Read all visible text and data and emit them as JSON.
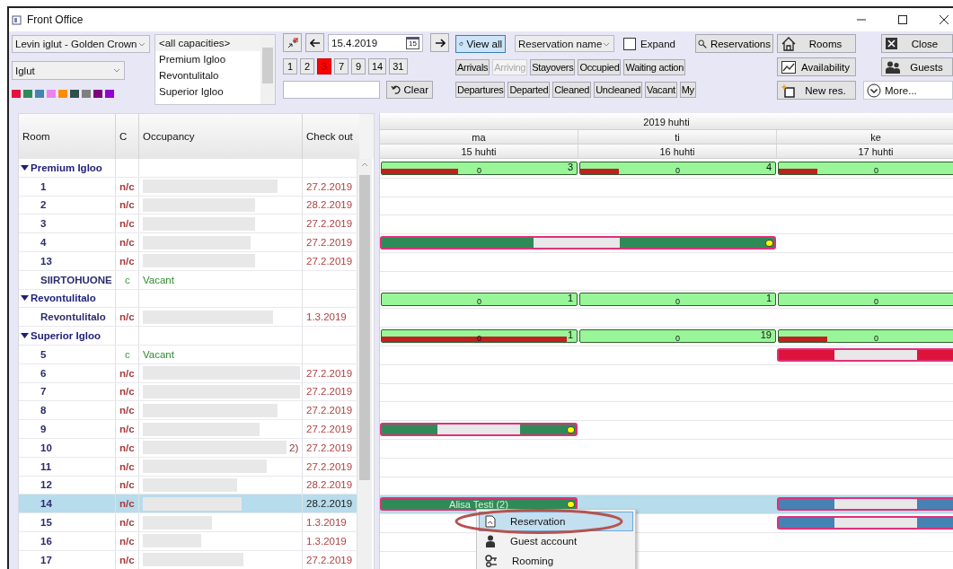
{
  "window": {
    "title": "Front Office"
  },
  "toolbar": {
    "property_select": "Levin iglut - Golden Crown",
    "type_select": "Iglut",
    "color_swatches": [
      {
        "color": "#e0143c"
      },
      {
        "color": "#2e8b57"
      },
      {
        "color": "#4682b4"
      },
      {
        "color": "#ee82ee"
      },
      {
        "color": "#ff8c00"
      },
      {
        "color": "#2f4f4f"
      },
      {
        "color": "#808080"
      },
      {
        "color": "#800080"
      },
      {
        "color": "#9400d3"
      }
    ],
    "capacities": [
      {
        "label": "<all capacities>",
        "selected": true
      },
      {
        "label": "Premium Igloo",
        "selected": false
      },
      {
        "label": "Revontulitalo",
        "selected": false
      },
      {
        "label": "Superior Igloo",
        "selected": false
      }
    ],
    "date_field": {
      "value": "15.4.2019",
      "calendar_icon": "15"
    },
    "day_buttons": [
      {
        "label": "1",
        "selected": false
      },
      {
        "label": "2",
        "selected": false
      },
      {
        "label": "3",
        "selected": true
      },
      {
        "label": "7",
        "selected": false
      },
      {
        "label": "9",
        "selected": false
      },
      {
        "label": "14",
        "selected": false
      },
      {
        "label": "31",
        "selected": false
      }
    ],
    "clear_button": "Clear",
    "view_all": {
      "label": "View all",
      "pressed": true
    },
    "sort_select": "Reservation name",
    "expand": {
      "label": "Expand",
      "checked": false
    },
    "filter_rows": [
      [
        {
          "label": "Arrivals",
          "disabled": false
        },
        {
          "label": "Arriving",
          "disabled": true
        },
        {
          "label": "Stayovers",
          "disabled": false
        },
        {
          "label": "Occupied",
          "disabled": false
        },
        {
          "label": "Waiting action",
          "disabled": false
        }
      ],
      [
        {
          "label": "Departures",
          "disabled": false
        },
        {
          "label": "Departed",
          "disabled": false
        },
        {
          "label": "Cleaned",
          "disabled": false
        },
        {
          "label": "Uncleaned",
          "disabled": false
        },
        {
          "label": "Vacant",
          "disabled": false
        },
        {
          "label": "My",
          "disabled": false
        }
      ]
    ],
    "reservations_button": "Reservations",
    "rooms_button": "Rooms",
    "availability_button": "Availability",
    "new_reservation_button": "New res.",
    "close_button": "Close",
    "guests_button": "Guests",
    "more_button": "More..."
  },
  "columns": [
    "Room",
    "C",
    "Occupancy",
    "Check out"
  ],
  "schedule": {
    "month": "2019 huhti",
    "days": [
      {
        "weekday": "ma",
        "date": "15 huhti"
      },
      {
        "weekday": "ti",
        "date": "16 huhti"
      },
      {
        "weekday": "ke",
        "date": "17 huhti"
      }
    ]
  },
  "rows": [
    {
      "kind": "group",
      "room": "Premium Igloo",
      "expanded": true,
      "selected": false,
      "availability": [
        {
          "level": 0.39,
          "free": "0",
          "count": "3"
        },
        {
          "level": 0.2,
          "free": "0",
          "count": "4"
        },
        {
          "level": 0.2,
          "free": "0"
        }
      ]
    },
    {
      "kind": "room",
      "room": "1",
      "status": "n/c",
      "clean": false,
      "occupancy_hidden": true,
      "check_out": "27.2.2019",
      "selected": false
    },
    {
      "kind": "room",
      "room": "2",
      "status": "n/c",
      "clean": false,
      "occupancy_hidden": true,
      "check_out": "28.2.2019",
      "selected": false
    },
    {
      "kind": "room",
      "room": "3",
      "status": "n/c",
      "clean": false,
      "occupancy_hidden": true,
      "check_out": "27.2.2019",
      "selected": false
    },
    {
      "kind": "room",
      "room": "4",
      "status": "n/c",
      "clean": false,
      "occupancy_hidden": true,
      "check_out": "27.2.2019",
      "selected": false,
      "slots": [
        {
          "booked": true,
          "color": "#2e8b57",
          "joins_next": true,
          "label_hidden": true
        },
        {
          "booked": true,
          "color": "#2e8b57",
          "joins_next": false,
          "label_hidden": true,
          "marker": true
        },
        {
          "booked": false
        }
      ]
    },
    {
      "kind": "room",
      "room": "13",
      "status": "n/c",
      "clean": false,
      "occupancy_hidden": true,
      "check_out": "27.2.2019",
      "selected": false
    },
    {
      "kind": "room",
      "room": "SIIRTOHUONE",
      "status": "c",
      "clean": true,
      "occupancy": "Vacant",
      "selected": false
    },
    {
      "kind": "group",
      "room": "Revontulitalo",
      "expanded": true,
      "selected": false,
      "availability": [
        {
          "free": "0",
          "count": "1"
        },
        {
          "free": "0",
          "count": "1"
        },
        {
          "free": "0"
        }
      ]
    },
    {
      "kind": "room",
      "room": "Revontulitalo",
      "status": "n/c",
      "clean": false,
      "occupancy_hidden": true,
      "check_out": "1.3.2019",
      "selected": false
    },
    {
      "kind": "group",
      "room": "Superior Igloo",
      "expanded": true,
      "selected": false,
      "availability": [
        {
          "level": 0.95,
          "free": "0",
          "count": "1"
        },
        {
          "free": "0",
          "count": "19"
        },
        {
          "level": 0.25,
          "free": "0"
        }
      ]
    },
    {
      "kind": "room",
      "room": "5",
      "status": "c",
      "clean": true,
      "occupancy": "Vacant",
      "selected": false,
      "slots": [
        {
          "booked": false
        },
        {
          "booked": false
        },
        {
          "booked": true,
          "color": "#dc143c",
          "joins_next": false,
          "label_hidden": true
        }
      ]
    },
    {
      "kind": "room",
      "room": "6",
      "status": "n/c",
      "clean": false,
      "occupancy_hidden": true,
      "check_out": "27.2.2019",
      "selected": false
    },
    {
      "kind": "room",
      "room": "7",
      "status": "n/c",
      "clean": false,
      "occupancy_hidden": true,
      "check_out": "27.2.2019",
      "selected": false
    },
    {
      "kind": "room",
      "room": "8",
      "status": "n/c",
      "clean": false,
      "occupancy_hidden": true,
      "check_out": "27.2.2019",
      "selected": false
    },
    {
      "kind": "room",
      "room": "9",
      "status": "n/c",
      "clean": false,
      "occupancy_hidden": true,
      "check_out": "27.2.2019",
      "selected": false,
      "slots": [
        {
          "booked": true,
          "color": "#2e8b57",
          "joins_next": false,
          "label_hidden": true,
          "marker": true
        },
        {
          "booked": false
        },
        {
          "booked": false
        }
      ]
    },
    {
      "kind": "room",
      "room": "10",
      "status": "n/c",
      "clean": false,
      "occupancy_hidden": true,
      "occupancy_tail": "2)",
      "check_out": "27.2.2019",
      "selected": false
    },
    {
      "kind": "room",
      "room": "11",
      "status": "n/c",
      "clean": false,
      "occupancy_hidden": true,
      "check_out": "27.2.2019",
      "selected": false
    },
    {
      "kind": "room",
      "room": "12",
      "status": "n/c",
      "clean": false,
      "occupancy_hidden": true,
      "check_out": "28.2.2019",
      "selected": false
    },
    {
      "kind": "room",
      "room": "14",
      "status": "n/c",
      "clean": false,
      "occupancy_hidden": true,
      "check_out": "28.2.2019",
      "selected": true,
      "slots": [
        {
          "booked": true,
          "color": "#2e8b57",
          "joins_next": false,
          "label": "Alisa Testi (2)",
          "marker": true
        },
        {
          "booked": false
        },
        {
          "booked": true,
          "color": "#4682b4",
          "joins_next": false,
          "label_hidden": true
        }
      ]
    },
    {
      "kind": "room",
      "room": "15",
      "status": "n/c",
      "clean": false,
      "occupancy_hidden": true,
      "check_out": "1.3.2019",
      "selected": false,
      "slots": [
        {
          "booked": false
        },
        {
          "booked": false
        },
        {
          "booked": true,
          "color": "#4682b4",
          "joins_next": false,
          "label_hidden": true
        }
      ]
    },
    {
      "kind": "room",
      "room": "16",
      "status": "n/c",
      "clean": false,
      "occupancy_hidden": true,
      "check_out": "1.3.2019",
      "selected": false
    },
    {
      "kind": "room",
      "room": "17",
      "status": "n/c",
      "clean": false,
      "occupancy_hidden": true,
      "check_out": "27.2.2019",
      "selected": false
    }
  ],
  "context_menu": {
    "items": [
      {
        "label": "Reservation",
        "selected": true
      },
      {
        "label": "Guest account",
        "selected": false
      },
      {
        "label": "Rooming",
        "selected": false
      }
    ]
  }
}
